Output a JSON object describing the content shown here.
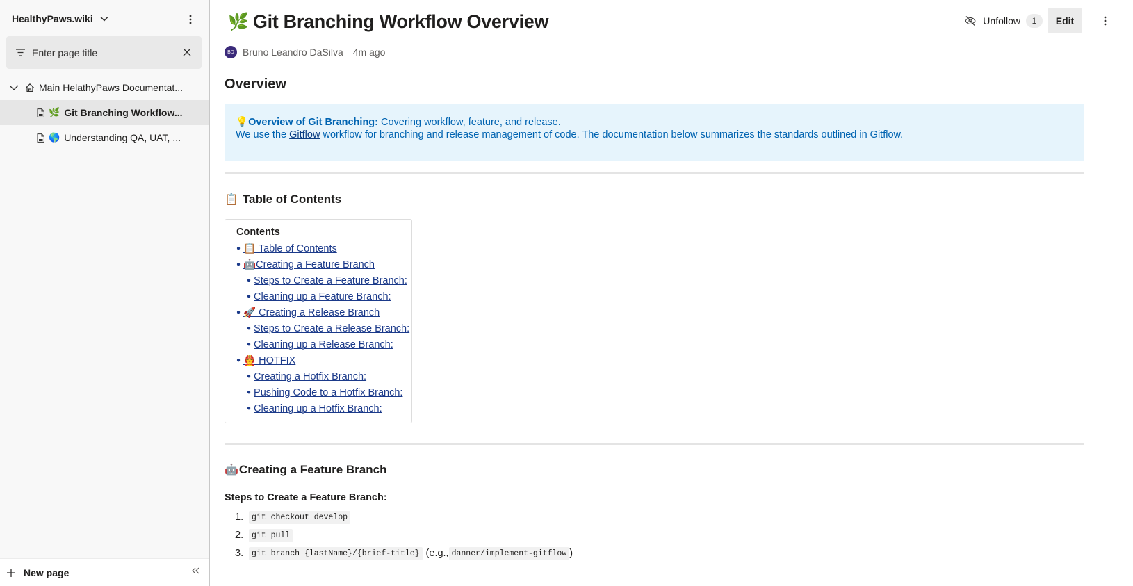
{
  "sidebar": {
    "wiki_name": "HealthyPaws.wiki",
    "filter_placeholder": "Enter page title",
    "tree": {
      "root_label": "Main HelathyPaws Documentat...",
      "children": [
        {
          "emoji": "🌿",
          "label": "Git Branching Workflow..."
        },
        {
          "emoji": "🌎",
          "label": "Understanding QA, UAT, ..."
        }
      ]
    },
    "new_page_label": "New page"
  },
  "header": {
    "title_emoji": "🌿",
    "title": "Git Branching Workflow Overview",
    "unfollow_label": "Unfollow",
    "follower_count": "1",
    "edit_label": "Edit",
    "author_initials": "BD",
    "author_name": "Bruno Leandro DaSilva",
    "time_ago": "4m ago"
  },
  "content": {
    "overview_heading": "Overview",
    "callout": {
      "emoji": "💡",
      "bold": "Overview of Git Branching:",
      "rest": " Covering workflow, feature, and release.",
      "line2_pre": "We use the ",
      "line2_link": "Gitflow",
      "line2_post": " workflow for branching and release management of code. The documentation below summarizes the standards outlined in Gitflow."
    },
    "toc_section": {
      "emoji": "📋",
      "heading": "Table of Contents"
    },
    "toc": {
      "heading": "Contents",
      "items": [
        {
          "text": "📋 Table of Contents"
        },
        {
          "text": "🤖Creating a Feature Branch"
        },
        {
          "text": "Steps to Create a Feature Branch:"
        },
        {
          "text": "Cleaning up a Feature Branch:"
        },
        {
          "text": "🚀 Creating a Release Branch"
        },
        {
          "text": "Steps to Create a Release Branch:"
        },
        {
          "text": "Cleaning up a Release Branch:"
        },
        {
          "text": "👨‍🚒 HOTFIX"
        },
        {
          "text": "Creating a Hotfix Branch:"
        },
        {
          "text": "Pushing Code to a Hotfix Branch:"
        },
        {
          "text": "Cleaning up a Hotfix Branch:"
        }
      ]
    },
    "feature_section": {
      "emoji": "🤖",
      "heading": "Creating a Feature Branch"
    },
    "steps_heading": "Steps to Create a Feature Branch:",
    "steps": [
      {
        "num": "1.",
        "code": "git checkout develop"
      },
      {
        "num": "2.",
        "code": "git pull"
      },
      {
        "num": "3.",
        "code": "git branch {lastName}/{brief-title}",
        "pre": "(e.g., ",
        "example": "danner/implement-gitflow",
        "post": ")"
      }
    ]
  }
}
